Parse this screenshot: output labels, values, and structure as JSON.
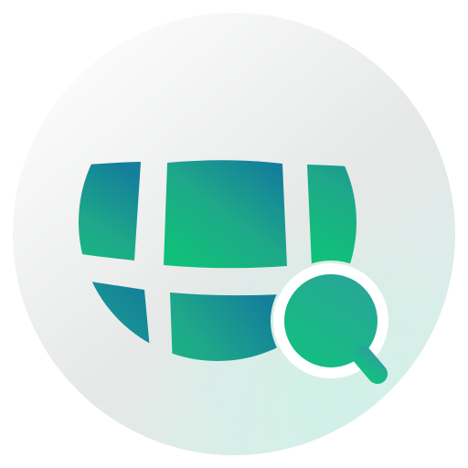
{
  "icon": {
    "name": "globe-search-icon",
    "colors": {
      "background_light": "#f7f8f8",
      "background_mid": "#e6e8e8",
      "background_tint": "#d9f1ec",
      "globe_teal": "#1e8fa0",
      "globe_green": "#18b87e",
      "search_teal": "#25a998",
      "search_green": "#17bd82"
    }
  }
}
